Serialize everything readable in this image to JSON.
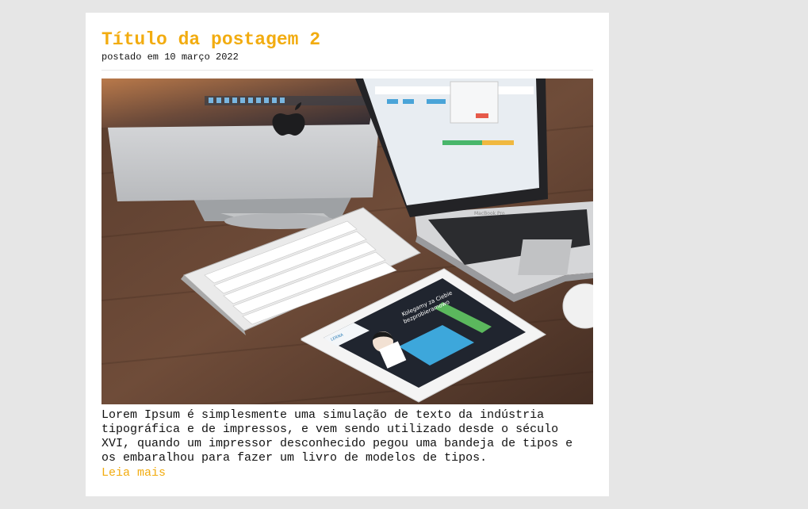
{
  "post": {
    "title": "Título da postagem 2",
    "meta": "postado em 10 março 2022",
    "image": {
      "description_icons": [
        "imac-icon",
        "macbook-icon",
        "keyboard-icon",
        "ipad-icon",
        "mouse-icon"
      ],
      "tablet_headline": "Kolegamy za Ciebie",
      "tablet_subheadline": "bezprobieramowo",
      "laptop_brand": "MacBook Pro",
      "tablet_brand": "LERNA"
    },
    "body": "Lorem Ipsum é simplesmente uma simulação de texto da indústria tipográfica e de impressos, e vem sendo utilizado desde o século XVI, quando um impressor desconhecido pegou uma bandeja de tipos e os embaralhou para fazer um livro de modelos de tipos.",
    "read_more": "Leia mais"
  },
  "colors": {
    "accent": "#f2ac10",
    "background": "#e6e6e6",
    "card": "#ffffff"
  }
}
